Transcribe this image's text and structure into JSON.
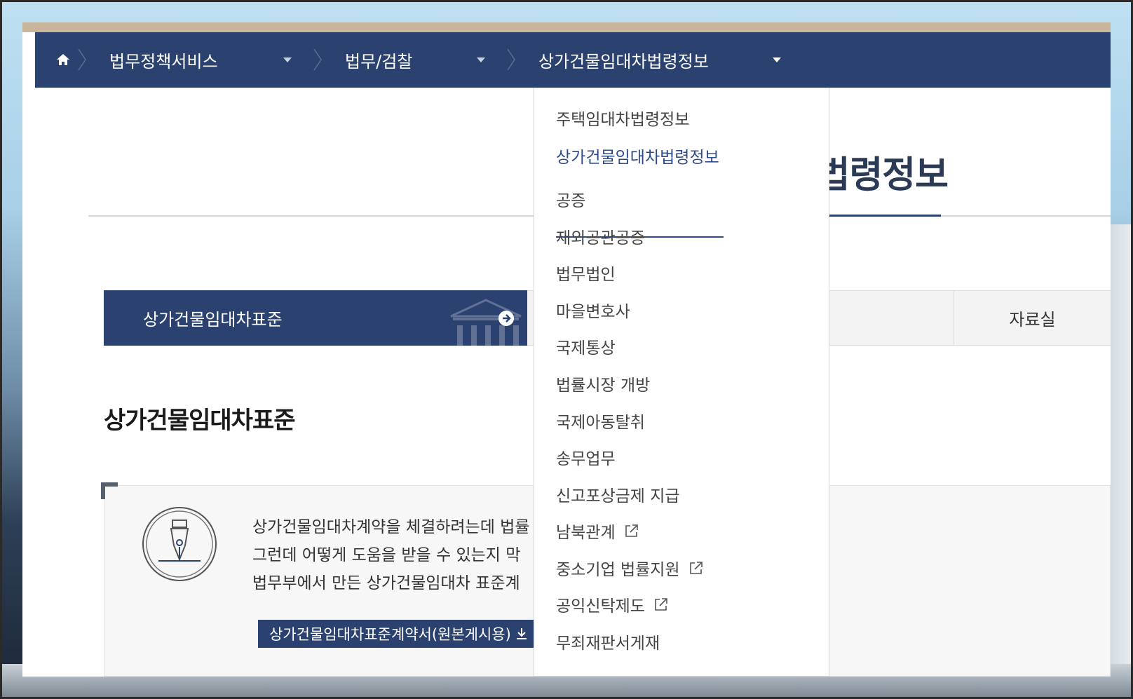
{
  "breadcrumb": {
    "level1": "법무정책서비스",
    "level2": "법무/검찰",
    "level3": "상가건물임대차법령정보"
  },
  "page_title": "상가건물임대차법령정보",
  "page_title_visible": "령정보",
  "tabs": {
    "active": "상가건물임대차표준",
    "archive": "자료실"
  },
  "section_title": "상가건물임대차표준",
  "info": {
    "line1": "상가건물임대차계약을 체결하려는데 법률",
    "line2": "그런데 어떻게 도움을 받을 수 있는지 막",
    "line3": "법무부에서 만든 상가건물임대차 표준계",
    "download_label": "상가건물임대차표준계약서(원본게시용)"
  },
  "dropdown": {
    "items": [
      {
        "label": "주택임대차법령정보"
      },
      {
        "label": "상가건물임대차법령정보"
      },
      {
        "label": "공증"
      },
      {
        "label": "재외공관공증"
      },
      {
        "label": "법무법인"
      },
      {
        "label": "마을변호사"
      },
      {
        "label": "국제통상"
      },
      {
        "label": "법률시장 개방"
      },
      {
        "label": "국제아동탈취"
      },
      {
        "label": "송무업무"
      },
      {
        "label": "신고포상금제 지급"
      },
      {
        "label": "남북관계"
      },
      {
        "label": "중소기업 법률지원"
      },
      {
        "label": "공익신탁제도"
      },
      {
        "label": "무죄재판서게재"
      }
    ]
  },
  "colors": {
    "navy": "#2b4170",
    "active_link": "#2f4a8a"
  }
}
